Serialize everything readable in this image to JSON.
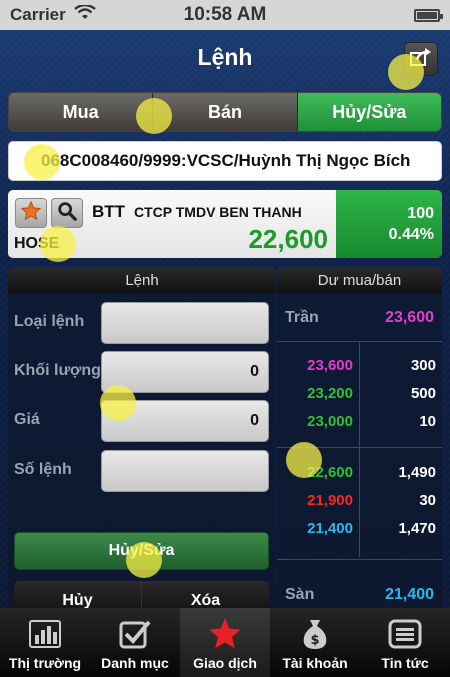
{
  "status_bar": {
    "carrier": "Carrier",
    "time": "10:58 AM"
  },
  "nav": {
    "title": "Lệnh",
    "share_icon": "share-icon"
  },
  "segments": [
    {
      "label": "Mua",
      "active": false
    },
    {
      "label": "Bán",
      "active": false
    },
    {
      "label": "Hủy/Sửa",
      "active": true
    }
  ],
  "account": "068C008460/9999:VCSC/Huỳnh Thị Ngọc Bích",
  "stock": {
    "symbol": "BTT",
    "name": "CTCP TMDV BEN THANH",
    "exchange": "HOSE",
    "price": "22,600",
    "change": "100",
    "change_pct": "0.44%"
  },
  "order_panel": {
    "header": "Lệnh",
    "fields": [
      {
        "label": "Loại lệnh",
        "value": ""
      },
      {
        "label": "Khối lượng",
        "value": "0"
      },
      {
        "label": "Giá",
        "value": "0"
      },
      {
        "label": "Số lệnh",
        "value": ""
      }
    ],
    "primary_button": "Hủy/Sửa",
    "cancel_button": "Hủy",
    "delete_button": "Xóa"
  },
  "depth_panel": {
    "header": "Dư mua/bán",
    "ceiling_label": "Trần",
    "ceiling_value": "23,600",
    "floor_label": "Sàn",
    "floor_value": "21,400",
    "sell_rows": [
      {
        "price": "23,600",
        "volume": "300",
        "color": "#e040c8"
      },
      {
        "price": "23,200",
        "volume": "500",
        "color": "#2fbf3a"
      },
      {
        "price": "23,000",
        "volume": "10",
        "color": "#2fbf3a"
      }
    ],
    "buy_rows": [
      {
        "price": "22,600",
        "volume": "1,490",
        "color": "#2fbf3a"
      },
      {
        "price": "21,900",
        "volume": "30",
        "color": "#ee2a2a"
      },
      {
        "price": "21,400",
        "volume": "1,470",
        "color": "#2ab8ee"
      }
    ]
  },
  "tabs": [
    {
      "label": "Thị trường",
      "icon": "bar-chart-icon",
      "active": false
    },
    {
      "label": "Danh mục",
      "icon": "checkbox-icon",
      "active": false
    },
    {
      "label": "Giao dịch",
      "icon": "star-icon",
      "active": true
    },
    {
      "label": "Tài khoản",
      "icon": "money-bag-icon",
      "active": false
    },
    {
      "label": "Tin tức",
      "icon": "news-icon",
      "active": false
    }
  ],
  "colors": {
    "ceiling": "#e040c8",
    "floor": "#2ab8ee",
    "up": "#1a9c2c",
    "active_green": "#2fb548"
  }
}
